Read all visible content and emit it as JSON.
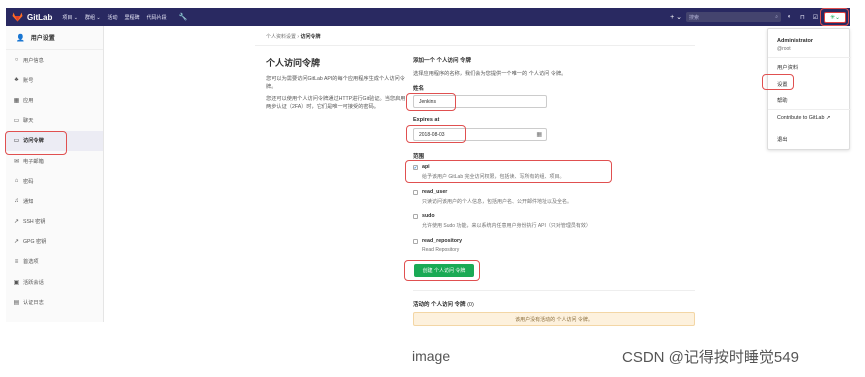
{
  "topbar": {
    "brand": "GitLab",
    "nav": [
      "项目 ⌄",
      "群组 ⌄",
      "活动",
      "里程碑",
      "代码片段"
    ],
    "wrench_icon": "wrench-icon",
    "plus": "+ ⌄",
    "search_placeholder": "搜索",
    "icons": [
      "issues-icon",
      "merge-request-icon",
      "todo-icon"
    ],
    "bg_color": "#292961"
  },
  "sidebar": {
    "title": "用户设置",
    "items": [
      {
        "icon": "○",
        "label": "用户信息"
      },
      {
        "icon": "♣",
        "label": "账号"
      },
      {
        "icon": "▦",
        "label": "应用"
      },
      {
        "icon": "▭",
        "label": "聊天"
      },
      {
        "icon": "▭",
        "label": "访问令牌"
      },
      {
        "icon": "✉",
        "label": "电子邮箱"
      },
      {
        "icon": "⌂",
        "label": "密码"
      },
      {
        "icon": "♫",
        "label": "通知"
      },
      {
        "icon": "↗",
        "label": "SSH 密钥"
      },
      {
        "icon": "↗",
        "label": "GPG 密钥"
      },
      {
        "icon": "≡",
        "label": "首选项"
      },
      {
        "icon": "▣",
        "label": "活跃会话"
      },
      {
        "icon": "▤",
        "label": "认证日志"
      }
    ]
  },
  "breadcrumb": {
    "parent": "个人资料设置",
    "sep": " › ",
    "current": "访问令牌"
  },
  "intro": {
    "title": "个人访问令牌",
    "p1": "您可以为需要访问GitLab API的每个应用程序生成个人访问令牌。",
    "p2": "您还可以使用个人访问令牌通过HTTP进行Git验证。当您启用两步认证（2FA）时，它们是唯一可接受的密码。"
  },
  "form": {
    "title": "添加一个 个人访问 令牌",
    "subtitle": "选择应用程序的名称，我们会为您提供一个唯一的 个人访问 令牌。",
    "name_label": "姓名",
    "name_value": "Jenkins",
    "expires_label": "Expires at",
    "expires_value": "2018-08-03",
    "scopes_label": "范围",
    "scopes": [
      {
        "name": "api",
        "checked": "✔",
        "desc": "给予该用户 GitLab 完全访问权限，包括读、写所有的组、项目。"
      },
      {
        "name": "read_user",
        "checked": "",
        "desc": "只读访问该用户的个人信息，包括用户名、公开邮件地址以及全名。"
      },
      {
        "name": "sudo",
        "checked": "",
        "desc": "允许使用 Sudo 功能，来以系统内任意用户身份执行 API（只对管理员有效）"
      },
      {
        "name": "read_repository",
        "checked": "",
        "desc": "Read Repository"
      }
    ],
    "submit": "创建 个人访问 令牌"
  },
  "active_tokens": {
    "title": "活动的 个人访问 令牌",
    "count": "(0)",
    "empty": "该用户没有活动的 个人访问 令牌。"
  },
  "dropdown": {
    "name": "Administrator",
    "username": "@root",
    "items": [
      "用户资料",
      "设置",
      "帮助",
      "Contribute to GitLab ↗",
      "退出"
    ]
  },
  "caption": "image",
  "watermark": "CSDN @记得按时睡觉549",
  "colors": {
    "accent_green": "#1aaa55",
    "highlight_red": "#e05050"
  }
}
